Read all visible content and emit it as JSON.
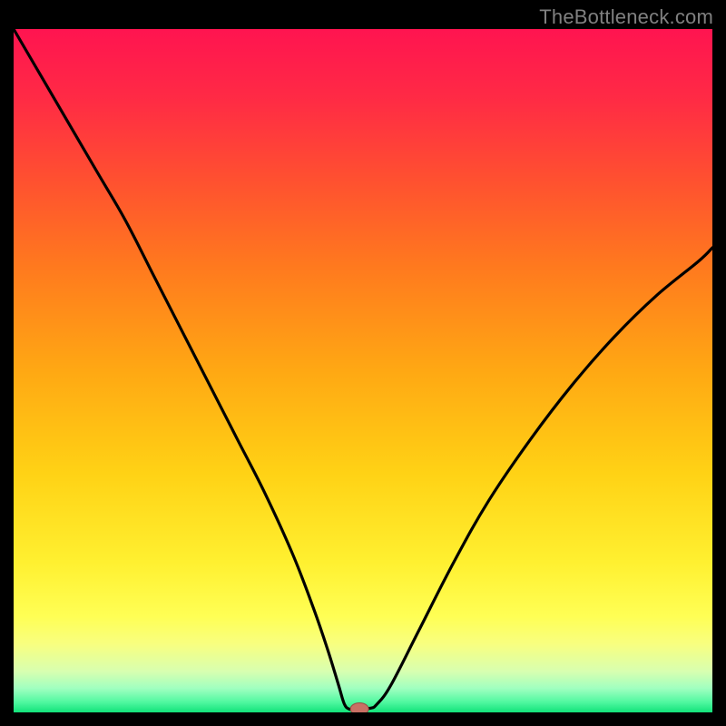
{
  "watermark": "TheBottleneck.com",
  "colors": {
    "black": "#000000",
    "curve": "#000000",
    "gradient_stops": [
      {
        "offset": 0.0,
        "color": "#ff1450"
      },
      {
        "offset": 0.1,
        "color": "#ff2a45"
      },
      {
        "offset": 0.22,
        "color": "#ff5030"
      },
      {
        "offset": 0.35,
        "color": "#ff7a1e"
      },
      {
        "offset": 0.5,
        "color": "#ffa813"
      },
      {
        "offset": 0.65,
        "color": "#ffd215"
      },
      {
        "offset": 0.78,
        "color": "#fff030"
      },
      {
        "offset": 0.86,
        "color": "#ffff55"
      },
      {
        "offset": 0.9,
        "color": "#f8ff80"
      },
      {
        "offset": 0.94,
        "color": "#d8ffb0"
      },
      {
        "offset": 0.965,
        "color": "#a0ffc0"
      },
      {
        "offset": 0.985,
        "color": "#50f8a0"
      },
      {
        "offset": 1.0,
        "color": "#12e27a"
      }
    ],
    "marker_fill": "#c97064",
    "marker_stroke": "#9a4d45"
  },
  "chart_data": {
    "type": "line",
    "title": "",
    "xlabel": "",
    "ylabel": "",
    "xlim": [
      0,
      100
    ],
    "ylim": [
      0,
      100
    ],
    "legend": false,
    "grid": false,
    "series": [
      {
        "name": "bottleneck-curve",
        "x": [
          0,
          4,
          8,
          12,
          16,
          20,
          24,
          28,
          32,
          36,
          40,
          43,
          45,
          46.5,
          47.3,
          48,
          49,
          51,
          52,
          54,
          58,
          63,
          68,
          74,
          80,
          86,
          92,
          98,
          100
        ],
        "y": [
          100,
          93,
          86,
          79,
          72,
          64,
          56,
          48,
          40,
          32,
          23,
          15,
          9,
          4,
          1.3,
          0.5,
          0.5,
          0.6,
          1.2,
          4,
          12,
          22,
          31,
          40,
          48,
          55,
          61,
          66,
          68
        ]
      }
    ],
    "marker": {
      "x": 49.5,
      "y": 0.5,
      "rx": 1.3,
      "ry": 0.9
    }
  }
}
